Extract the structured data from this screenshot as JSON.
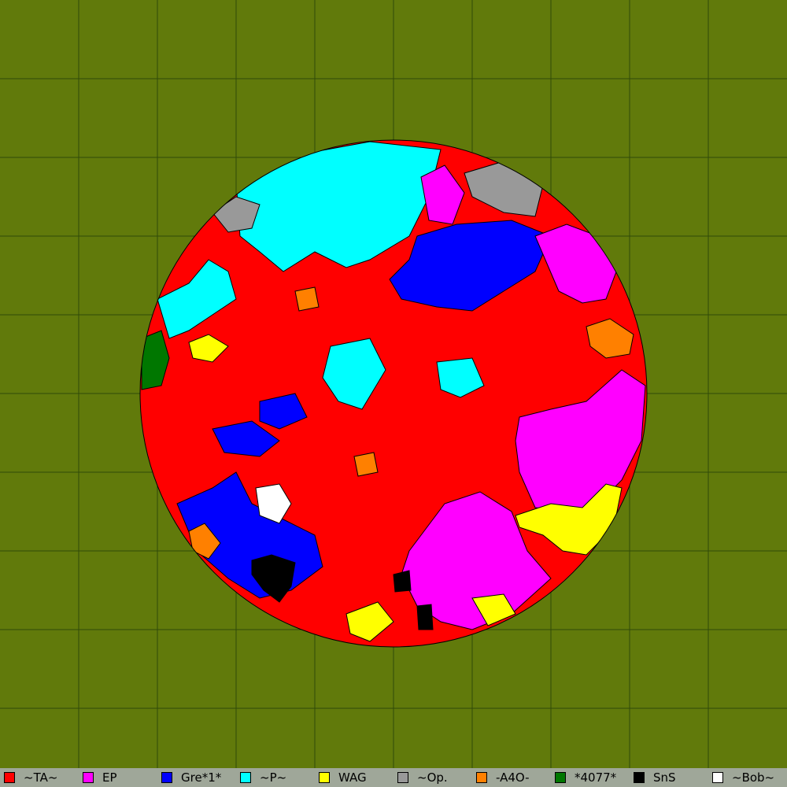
{
  "map": {
    "background_color": "#617a0b",
    "grid_color": "#2f4a08",
    "territory_cells": [
      {
        "team": "~P~",
        "color": "#00ffff",
        "region": "north"
      },
      {
        "team": "~Op.",
        "color": "#999999",
        "region": "north-east"
      },
      {
        "team": "EP",
        "color": "#ff00ff",
        "region": "east and south-east"
      },
      {
        "team": "Gre*1*",
        "color": "#0000ff",
        "region": "north-east and south-west"
      },
      {
        "team": "WAG",
        "color": "#ffff00",
        "region": "south and south-east edge"
      },
      {
        "team": "-A4O-",
        "color": "#ff8000",
        "region": "east edge"
      },
      {
        "team": "*4077*",
        "color": "#007700",
        "region": "west edge"
      },
      {
        "team": "SnS",
        "color": "#000000",
        "region": "south"
      },
      {
        "team": "~Bob~",
        "color": "#ffffff",
        "region": "south-west"
      },
      {
        "team": "~TA~",
        "color": "#ff0000",
        "region": "center"
      }
    ]
  },
  "legend": [
    {
      "name": "~TA~",
      "color": "#ff0000"
    },
    {
      "name": "EP",
      "color": "#ff00ff"
    },
    {
      "name": "Gre*1*",
      "color": "#0000ff"
    },
    {
      "name": "~P~",
      "color": "#00ffff"
    },
    {
      "name": "WAG",
      "color": "#ffff00"
    },
    {
      "name": "~Op.",
      "color": "#999999"
    },
    {
      "name": "-A4O-",
      "color": "#ff8000"
    },
    {
      "name": "*4077*",
      "color": "#007700"
    },
    {
      "name": "SnS",
      "color": "#000000"
    },
    {
      "name": "~Bob~",
      "color": "#ffffff"
    }
  ]
}
